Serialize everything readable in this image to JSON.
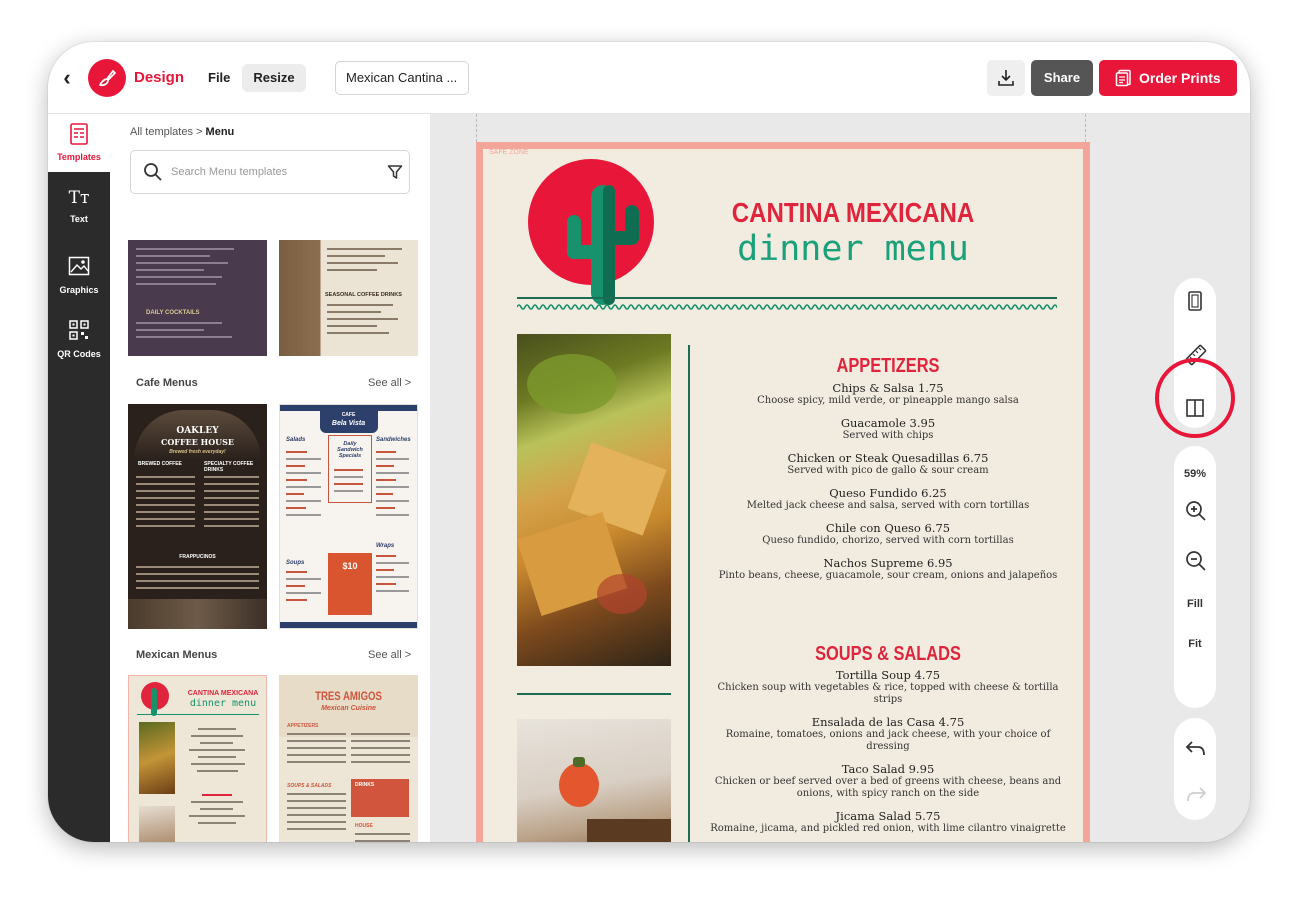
{
  "topbar": {
    "brand": "Design",
    "file_label": "File",
    "resize_label": "Resize",
    "doc_title": "Mexican Cantina ...",
    "share_label": "Share",
    "order_label": "Order Prints"
  },
  "rail": {
    "items": [
      {
        "label": "Templates",
        "icon": "templates-icon"
      },
      {
        "label": "Text",
        "icon": "text-icon"
      },
      {
        "label": "Graphics",
        "icon": "graphics-icon"
      },
      {
        "label": "QR Codes",
        "icon": "qr-icon"
      }
    ]
  },
  "panel": {
    "breadcrumb_root": "All templates",
    "breadcrumb_sep": ">",
    "breadcrumb_current": "Menu",
    "search_placeholder": "Search Menu templates",
    "sections": [
      {
        "title": "Cafe Menus",
        "see_all": "See all >"
      },
      {
        "title": "Mexican Menus",
        "see_all": "See all >"
      }
    ],
    "thumbs": {
      "cocktails": "DAILY COCKTAILS",
      "seasonal": "SEASONAL COFFEE DRINKS",
      "oakley_1": "OAKLEY",
      "oakley_2": "COFFEE HOUSE",
      "oakley_sub": "Brewed fresh everyday!",
      "oakley_col1": "BREWED COFFEE",
      "oakley_col2": "SPECIALTY COFFEE DRINKS",
      "oakley_frap": "FRAPPUCINOS",
      "bela_cafe": "CAFE",
      "bela_name": "Bela Vista",
      "bela_salads": "Salads",
      "bela_sandwiches": "Sandwiches",
      "bela_daily": "Daily Sandwich Specials",
      "bela_lunch": "$10",
      "bela_soups": "Soups",
      "bela_wraps": "Wraps",
      "cantina_1": "CANTINA MEXICANA",
      "cantina_2": "dinner menu",
      "tres_1": "TRES AMIGOS",
      "tres_2": "Mexican Cuisine",
      "tres_app": "APPETIZERS",
      "tres_soups": "SOUPS & SALADS",
      "tres_drinks": "DRINKS",
      "tres_house": "HOUSE"
    }
  },
  "canvas": {
    "safe_zone": "SAFE ZONE",
    "title_line1": "CANTINA MEXICANA",
    "title_line2": "dinner menu",
    "appetizers_head": "APPETIZERS",
    "appetizers": [
      {
        "name": "Chips & Salsa  1.75",
        "desc": "Choose spicy, mild verde, or pineapple mango salsa"
      },
      {
        "name": "Guacamole  3.95",
        "desc": "Served with chips"
      },
      {
        "name": "Chicken or Steak Quesadillas  6.75",
        "desc": "Served with pico de gallo & sour cream"
      },
      {
        "name": "Queso Fundido  6.25",
        "desc": "Melted jack cheese and salsa, served with corn tortillas"
      },
      {
        "name": "Chile con Queso  6.75",
        "desc": "Queso fundido, chorizo, served with corn tortillas"
      },
      {
        "name": "Nachos Supreme  6.95",
        "desc": "Pinto beans, cheese, guacamole, sour cream, onions and jalapeños"
      }
    ],
    "soups_head": "SOUPS & SALADS",
    "soups": [
      {
        "name": "Tortilla Soup  4.75",
        "desc": "Chicken soup with vegetables & rice, topped with cheese & tortilla strips"
      },
      {
        "name": "Ensalada de las Casa  4.75",
        "desc": "Romaine, tomatoes, onions and jack cheese, with your choice of dressing"
      },
      {
        "name": "Taco Salad  9.95",
        "desc": "Chicken or beef served over a bed of greens with cheese, beans and onions, with spicy ranch on the side"
      },
      {
        "name": "Jicama Salad  5.75",
        "desc": "Romaine, jicama, and pickled red onion, with lime cilantro vinaigrette"
      }
    ]
  },
  "toolbar": {
    "zoom": "59%",
    "fill_label": "Fill",
    "fit_label": "Fit"
  },
  "colors": {
    "brand_red": "#e8173a",
    "menu_green": "#1aa07a",
    "page_border": "#f4a59a"
  }
}
